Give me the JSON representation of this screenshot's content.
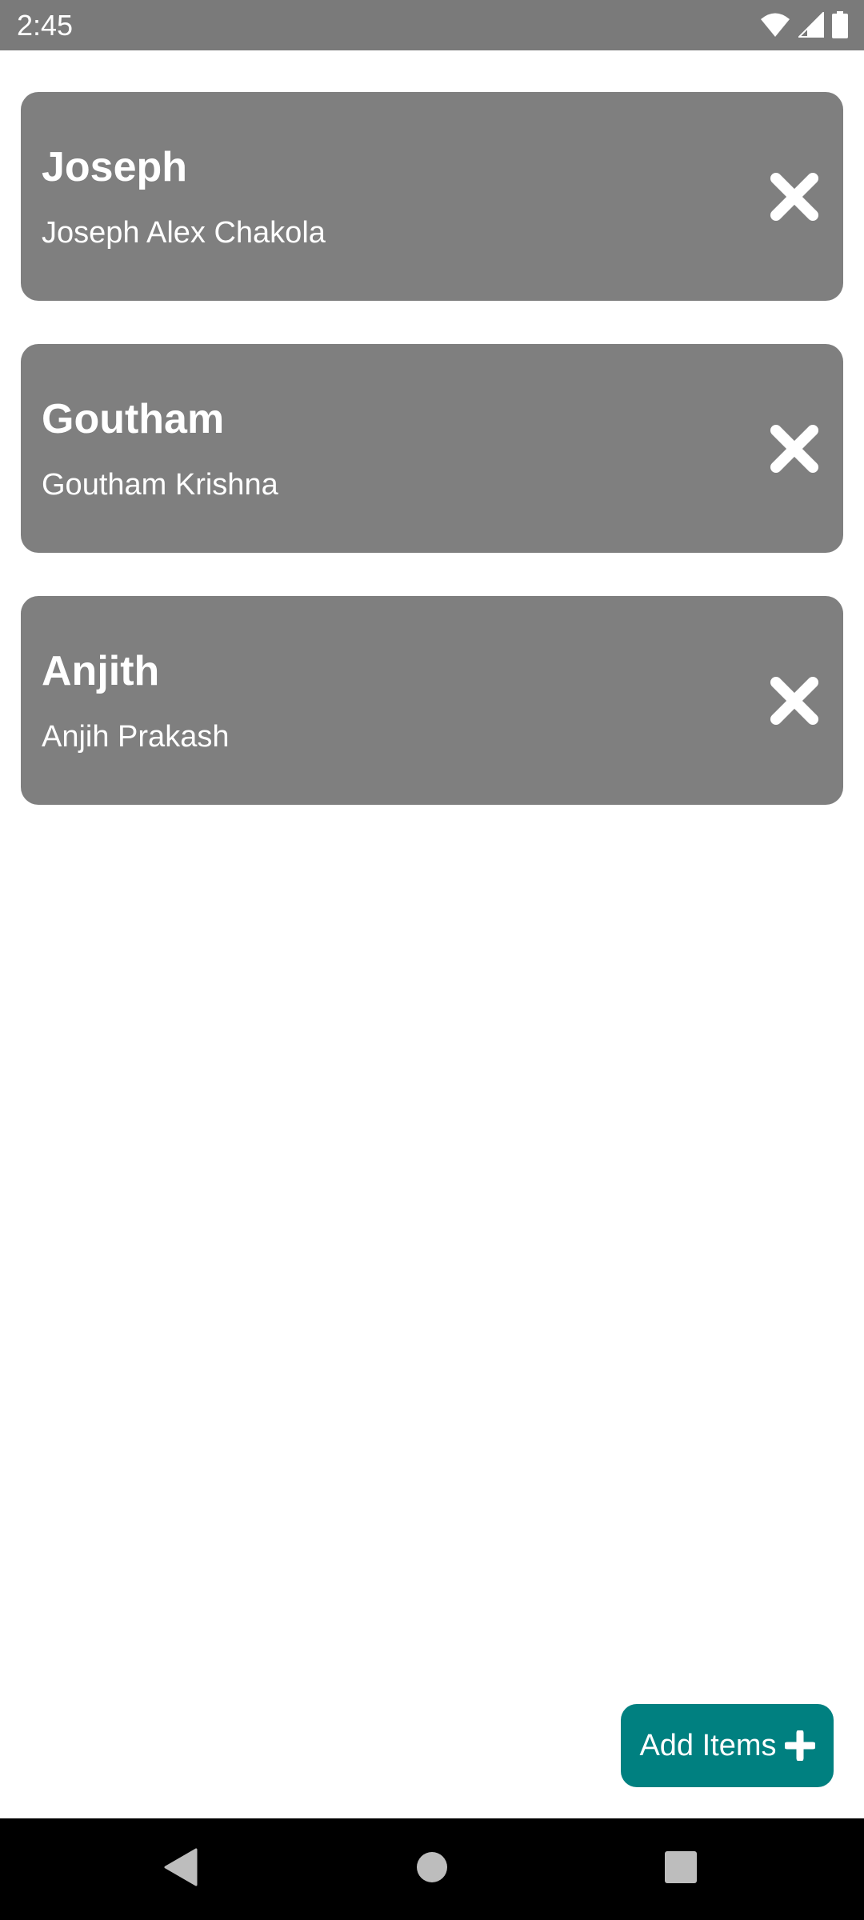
{
  "status_bar": {
    "time": "2:45",
    "icons": [
      "wifi-icon",
      "signal-icon",
      "battery-icon"
    ]
  },
  "items": [
    {
      "title": "Joseph",
      "subtitle": "Joseph Alex Chakola",
      "action_icon": "close-icon"
    },
    {
      "title": "Goutham",
      "subtitle": "Goutham Krishna",
      "action_icon": "close-icon"
    },
    {
      "title": "Anjith",
      "subtitle": "Anjih Prakash",
      "action_icon": "close-icon"
    }
  ],
  "fab": {
    "label": "Add Items",
    "icon": "plus-icon"
  },
  "nav_bar": {
    "buttons": [
      "back-icon",
      "home-icon",
      "recents-icon"
    ]
  },
  "colors": {
    "status_bar": "#7a7a7a",
    "card_background": "#7f7f7f",
    "card_text": "#ffffff",
    "fab_background": "#008080",
    "nav_bar": "#000000",
    "page_background": "#ffffff"
  }
}
